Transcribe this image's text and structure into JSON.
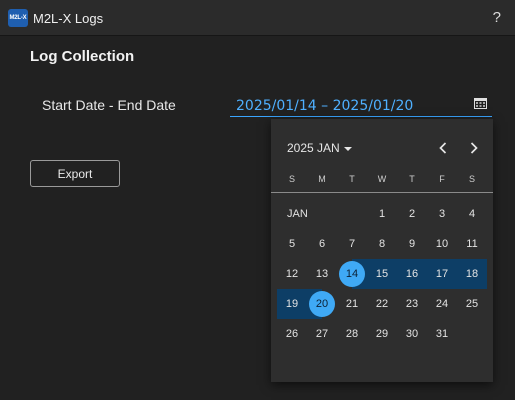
{
  "app": {
    "logo_text": "M2L-X",
    "title": "M2L-X Logs",
    "help_label": "?"
  },
  "page": {
    "section_title": "Log Collection"
  },
  "date_range": {
    "label": "Start Date - End Date",
    "value": "2025/01/14 – 2025/01/20",
    "icon": "calendar-icon",
    "accent_color": "#3aa5ff"
  },
  "export_button": {
    "label": "Export"
  },
  "datepicker": {
    "month_select_label": "2025 JAN",
    "month_label": "JAN",
    "prev_icon": "chevron-left-icon",
    "next_icon": "chevron-right-icon",
    "weekdays": [
      "S",
      "M",
      "T",
      "W",
      "T",
      "F",
      "S"
    ],
    "first_weekday_index": 3,
    "days_in_month": 31,
    "range_start": 14,
    "range_end": 20,
    "selected_color": "#3fa9f5",
    "range_color": "#0d3e66"
  }
}
